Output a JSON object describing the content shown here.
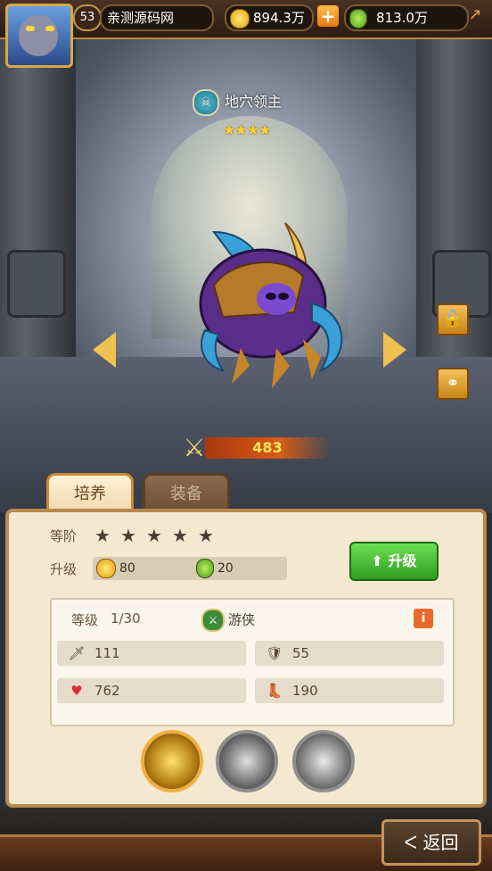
{
  "header": {
    "player_level": "53",
    "player_name": "亲测源码网",
    "gold": "894.3万",
    "potion": "813.0万"
  },
  "hero": {
    "name": "地穴领主",
    "stars": "★★★★",
    "power": "483"
  },
  "tabs": {
    "train": "培养",
    "equip": "装备"
  },
  "panel": {
    "grade_label": "等阶",
    "grade_stars": [
      "★",
      "★",
      "★",
      "★",
      "★"
    ],
    "upgrade_label": "升级",
    "cost_gold": "80",
    "cost_potion": "20",
    "upgrade_button": "升级",
    "level_label": "等级",
    "level_value": "1/30",
    "class_name": "游侠",
    "stats": {
      "attack": "111",
      "defense": "55",
      "hp": "762",
      "speed": "190"
    }
  },
  "footer": {
    "back": "返回"
  },
  "colors": {
    "accent": "#d9a64a",
    "upgrade_green": "#2f9c22"
  }
}
